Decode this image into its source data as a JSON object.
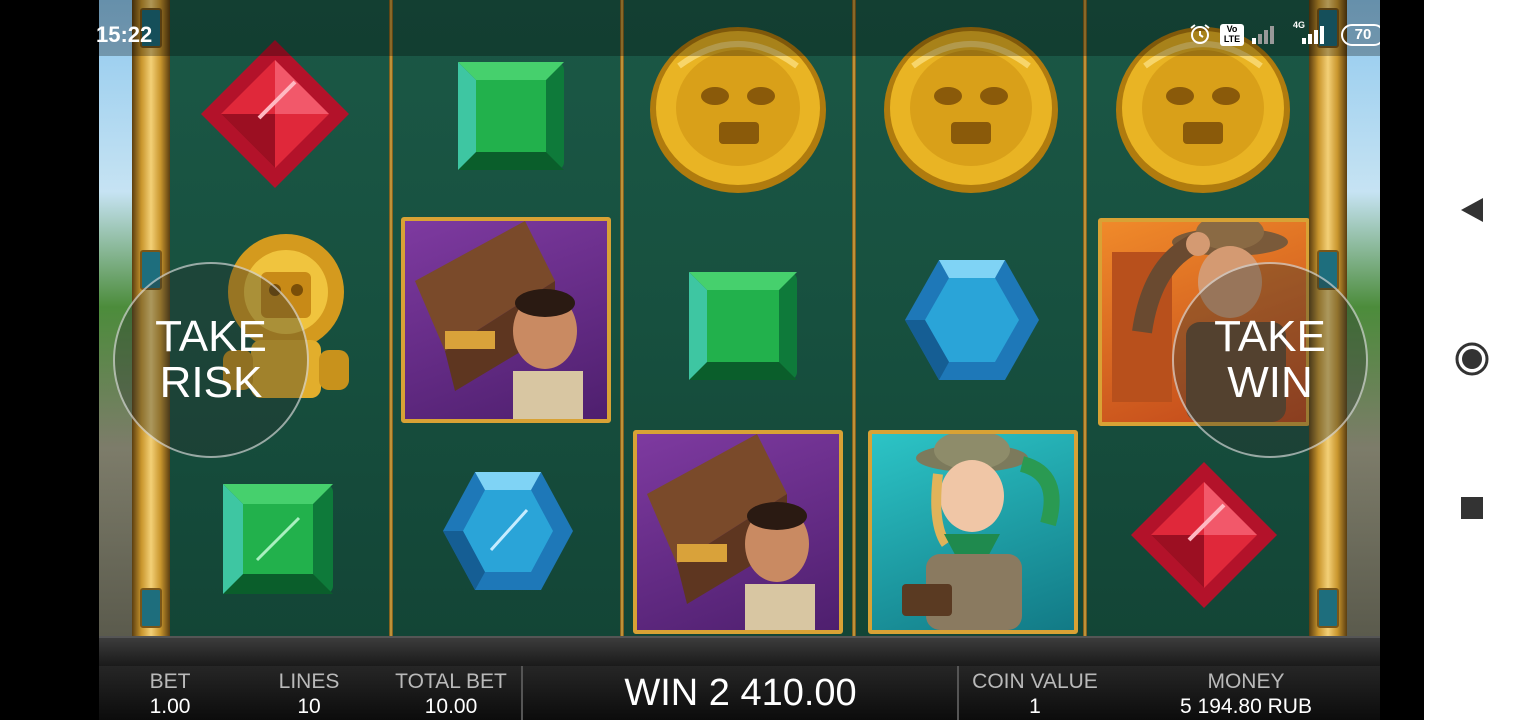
{
  "status_bar": {
    "time": "15:22",
    "network_label": "4G",
    "volte_label": "Vo LTE",
    "battery": "70"
  },
  "controls": {
    "take_risk": [
      "TAKE",
      "RISK"
    ],
    "take_win": [
      "TAKE",
      "WIN"
    ]
  },
  "bottom_bar": {
    "bet_label": "BET",
    "bet_value": "1.00",
    "lines_label": "LINES",
    "lines_value": "10",
    "total_bet_label": "TOTAL BET",
    "total_bet_value": "10.00",
    "win_text": "WIN 2 410.00",
    "coin_value_label": "COIN VALUE",
    "coin_value": "1",
    "money_label": "MONEY",
    "money_value": "5 194.80 RUB"
  },
  "reels": [
    [
      "red-gem",
      "gold-idol",
      "green-gem"
    ],
    [
      "green-gem",
      "porter-with-chest",
      "blue-gem"
    ],
    [
      "gold-coin",
      "green-gem",
      "porter-with-chest"
    ],
    [
      "gold-coin",
      "blue-gem",
      "explorer-woman"
    ],
    [
      "gold-coin",
      "explorer-man",
      "red-gem"
    ]
  ],
  "colors": {
    "reel_bg": "#17503f",
    "frame_gold": "#d8a235",
    "gem_red": "#e0283a",
    "gem_green": "#20b04a",
    "gem_blue": "#2aa4d8",
    "coin_gold": "#e9b424"
  },
  "nav_icons": [
    "back-icon",
    "home-icon",
    "recents-icon"
  ]
}
